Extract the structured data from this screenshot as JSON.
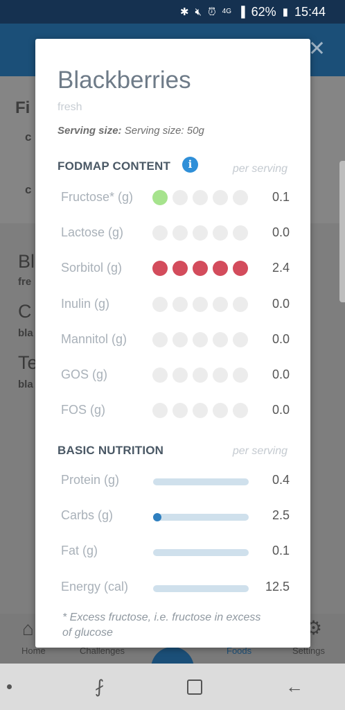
{
  "status_bar": {
    "battery": "62%",
    "time": "15:44",
    "network": "4G",
    "icons": [
      "bluetooth-icon",
      "mute-icon",
      "alarm-icon",
      "signal-icon",
      "battery-icon"
    ]
  },
  "background": {
    "fragments": [
      "Fi",
      "c",
      "c",
      "Bl",
      "fre",
      "C",
      "bla",
      "Te",
      "bla"
    ],
    "nav": [
      "Home",
      "Challenges",
      "Foods",
      "Settings"
    ]
  },
  "modal": {
    "title": "Blackberries",
    "variant": "fresh",
    "serving_label": "Serving size:",
    "serving_value": "Serving size: 50g",
    "fodmap_header": "FODMAP CONTENT",
    "fodmap_per": "per serving",
    "fodmap_rows": [
      {
        "label": "Fructose* (g)",
        "value": "0.1",
        "level": 1,
        "color": "#a6e38d"
      },
      {
        "label": "Lactose (g)",
        "value": "0.0",
        "level": 0,
        "color": ""
      },
      {
        "label": "Sorbitol (g)",
        "value": "2.4",
        "level": 5,
        "color": "#d34c5c"
      },
      {
        "label": "Inulin (g)",
        "value": "0.0",
        "level": 0,
        "color": ""
      },
      {
        "label": "Mannitol (g)",
        "value": "0.0",
        "level": 0,
        "color": ""
      },
      {
        "label": "GOS (g)",
        "value": "0.0",
        "level": 0,
        "color": ""
      },
      {
        "label": "FOS (g)",
        "value": "0.0",
        "level": 0,
        "color": ""
      }
    ],
    "nutrition_header": "BASIC NUTRITION",
    "nutrition_per": "per serving",
    "nutrition_rows": [
      {
        "label": "Protein (g)",
        "value": "0.4",
        "fill": 0.0
      },
      {
        "label": "Carbs (g)",
        "value": "2.5",
        "fill": 0.07
      },
      {
        "label": "Fat (g)",
        "value": "0.1",
        "fill": 0.0
      },
      {
        "label": "Energy (cal)",
        "value": "12.5",
        "fill": 0.0
      }
    ],
    "footnote": "* Excess fructose, i.e. fructose in excess of glucose"
  },
  "colors": {
    "accent": "#2f8fd8",
    "low": "#a6e38d",
    "high": "#d34c5c",
    "bar_track": "#cfe0ec",
    "bar_fill": "#2f7fbf"
  }
}
